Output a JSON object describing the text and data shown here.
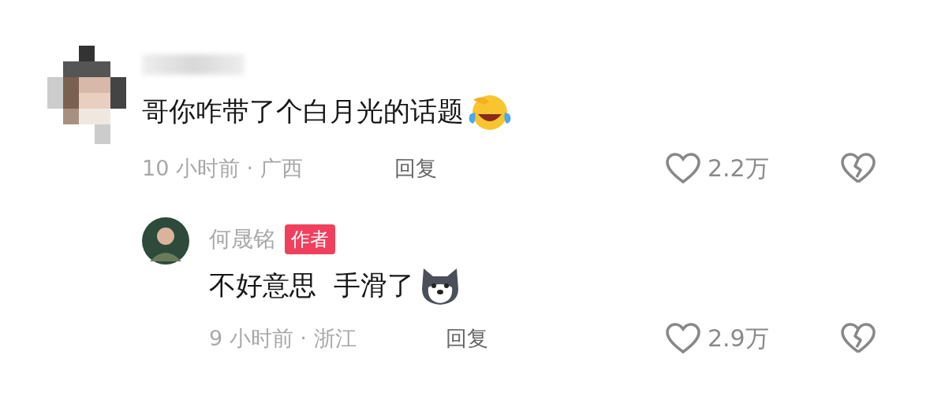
{
  "comments": [
    {
      "is_author": false,
      "text": "哥你咋带了个白月光的话题",
      "emoji": {
        "kind": "laugh-cry"
      },
      "time": "10 小时前 · 广西",
      "reply": "回复",
      "likes": "2.2万"
    },
    {
      "author": "何晟铭",
      "is_author": true,
      "badge": "作者",
      "text": "不好意思  手滑了",
      "emoji": {
        "kind": "husky"
      },
      "time": "9 小时前 · 浙江",
      "reply": "回复",
      "likes": "2.9万"
    }
  ]
}
